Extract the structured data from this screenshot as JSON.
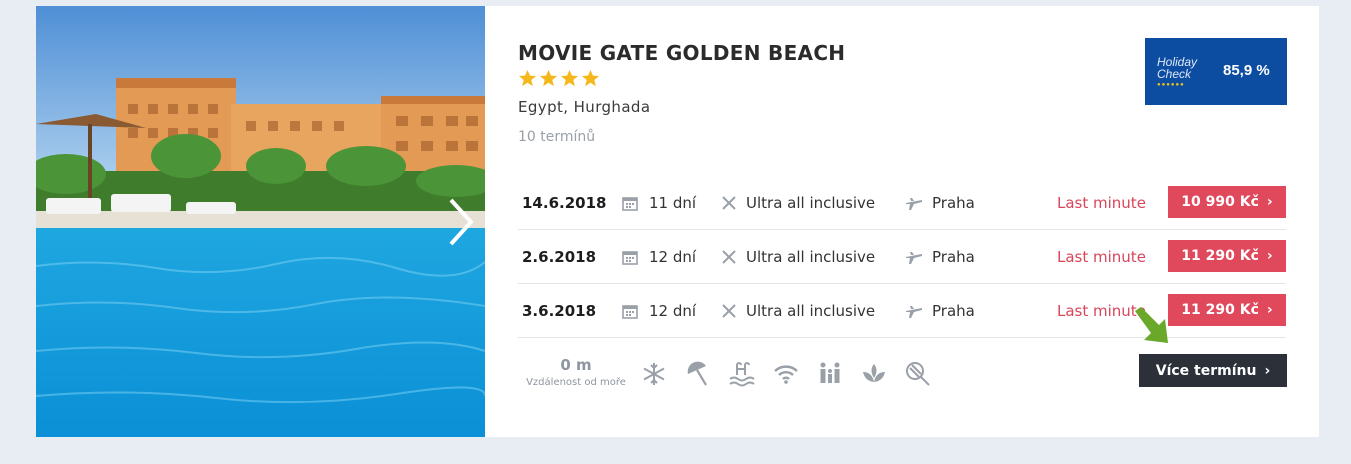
{
  "hotel": {
    "name": "MOVIE GATE GOLDEN BEACH",
    "stars": 4,
    "location": "Egypt, Hurghada",
    "terms_count": "10 termínů"
  },
  "rating": {
    "brand_line1": "Holiday",
    "brand_line2": "Check",
    "score": "85,9 %"
  },
  "offers": [
    {
      "date": "14.6.2018",
      "days": "11 dní",
      "board": "Ultra all inclusive",
      "departure": "Praha",
      "tag": "Last minute",
      "price": "10 990 Kč"
    },
    {
      "date": "2.6.2018",
      "days": "12 dní",
      "board": "Ultra all inclusive",
      "departure": "Praha",
      "tag": "Last minute",
      "price": "11 290 Kč"
    },
    {
      "date": "3.6.2018",
      "days": "12 dní",
      "board": "Ultra all inclusive",
      "departure": "Praha",
      "tag": "Last minute",
      "price": "11 290 Kč"
    }
  ],
  "features": {
    "distance_value": "0 m",
    "distance_label": "Vzdálenost od moře",
    "icons": [
      "air-conditioning-icon",
      "beach-umbrella-icon",
      "pool-icon",
      "wifi-icon",
      "family-icon",
      "wellness-icon",
      "tennis-icon"
    ]
  },
  "more_button": "Více termínu",
  "colors": {
    "accent": "#e0485c",
    "badge": "#0c4da2",
    "dark_button": "#2c3038",
    "star": "#f5b81c",
    "arrow": "#6aa829"
  }
}
